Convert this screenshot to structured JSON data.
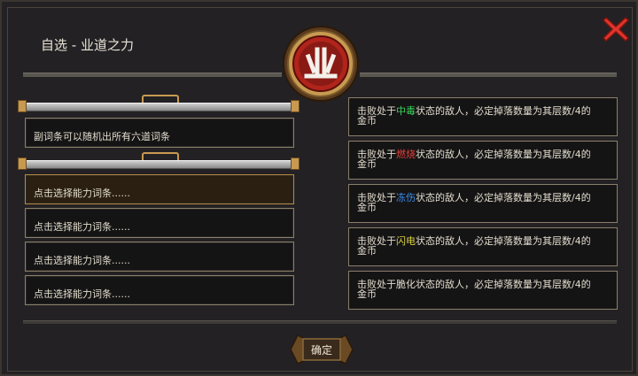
{
  "dialog": {
    "title": "自选 - 业道之力",
    "emblem_glyph": "业",
    "info_text": "副词条可以随机出所有六道词条",
    "slots": [
      "点击选择能力词条......",
      "点击选择能力词条......",
      "点击选择能力词条......",
      "点击选择能力词条......"
    ],
    "effects": [
      {
        "pre": "击败处于",
        "status": "中毒",
        "post": "状态的敌人，必定掉落数量为其层数/4的",
        "line2": "金币",
        "color": "#3ad65a"
      },
      {
        "pre": "击败处于",
        "status": "燃烧",
        "post": "状态的敌人，必定掉落数量为其层数/4的",
        "line2": "金币",
        "color": "#e0403a"
      },
      {
        "pre": "击败处于",
        "status": "冻伤",
        "post": "状态的敌人，必定掉落数量为其层数/4的",
        "line2": "金币",
        "color": "#3a8ef0"
      },
      {
        "pre": "击败处于",
        "status": "闪电",
        "post": "状态的敌人，必定掉落数量为其层数/4的",
        "line2": "金币",
        "color": "#d8d040"
      },
      {
        "pre": "击败处于",
        "status": "脆化",
        "post": "状态的敌人，必定掉落数量为其层数/4的",
        "line2": "金币",
        "color": "#e2dccd"
      }
    ],
    "confirm_label": "确定"
  },
  "colors": {
    "accent_gold": "#c89a50",
    "close_red": "#e0342a",
    "emblem_red": "#b0241c"
  },
  "icons": {
    "close": "close-x-icon",
    "emblem": "karma-emblem-icon"
  }
}
